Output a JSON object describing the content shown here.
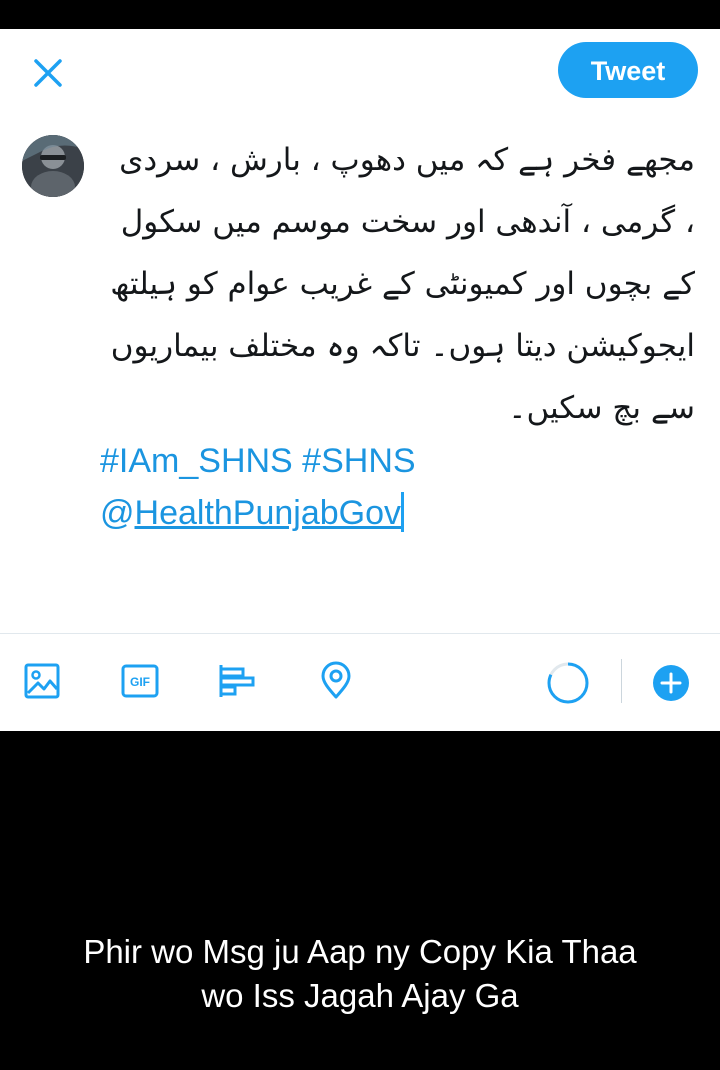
{
  "composer": {
    "tweet_button_label": "Tweet",
    "body_text": "مجھے فخر ہے کہ میں دھوپ ، بارش ، سردی ، گرمی ، آندھی اور سخت موسم میں سکول کے بچوں اور کمیونٹی کے غریب عوام کو ہیلتھ ایجوکیشن دیتا ہوں۔ تاکہ وہ مختلف بیماریوں سے بچ سکیں۔",
    "hashtags": "#IAm_SHNS #SHNS",
    "mention_at": "@",
    "mention_handle": "HealthPunjabGov"
  },
  "toolbar": {
    "icons": [
      "image-icon",
      "gif-icon",
      "poll-icon",
      "location-icon",
      "character-count-ring",
      "add-tweet-icon"
    ],
    "gif_label": "GIF"
  },
  "caption": {
    "line1": "Phir wo Msg ju Aap ny Copy Kia Thaa",
    "line2": "wo Iss Jagah Ajay Ga"
  },
  "colors": {
    "accent": "#1da1f2",
    "link": "#1b95e0",
    "text": "#14171a",
    "background_overlay": "#000000"
  }
}
